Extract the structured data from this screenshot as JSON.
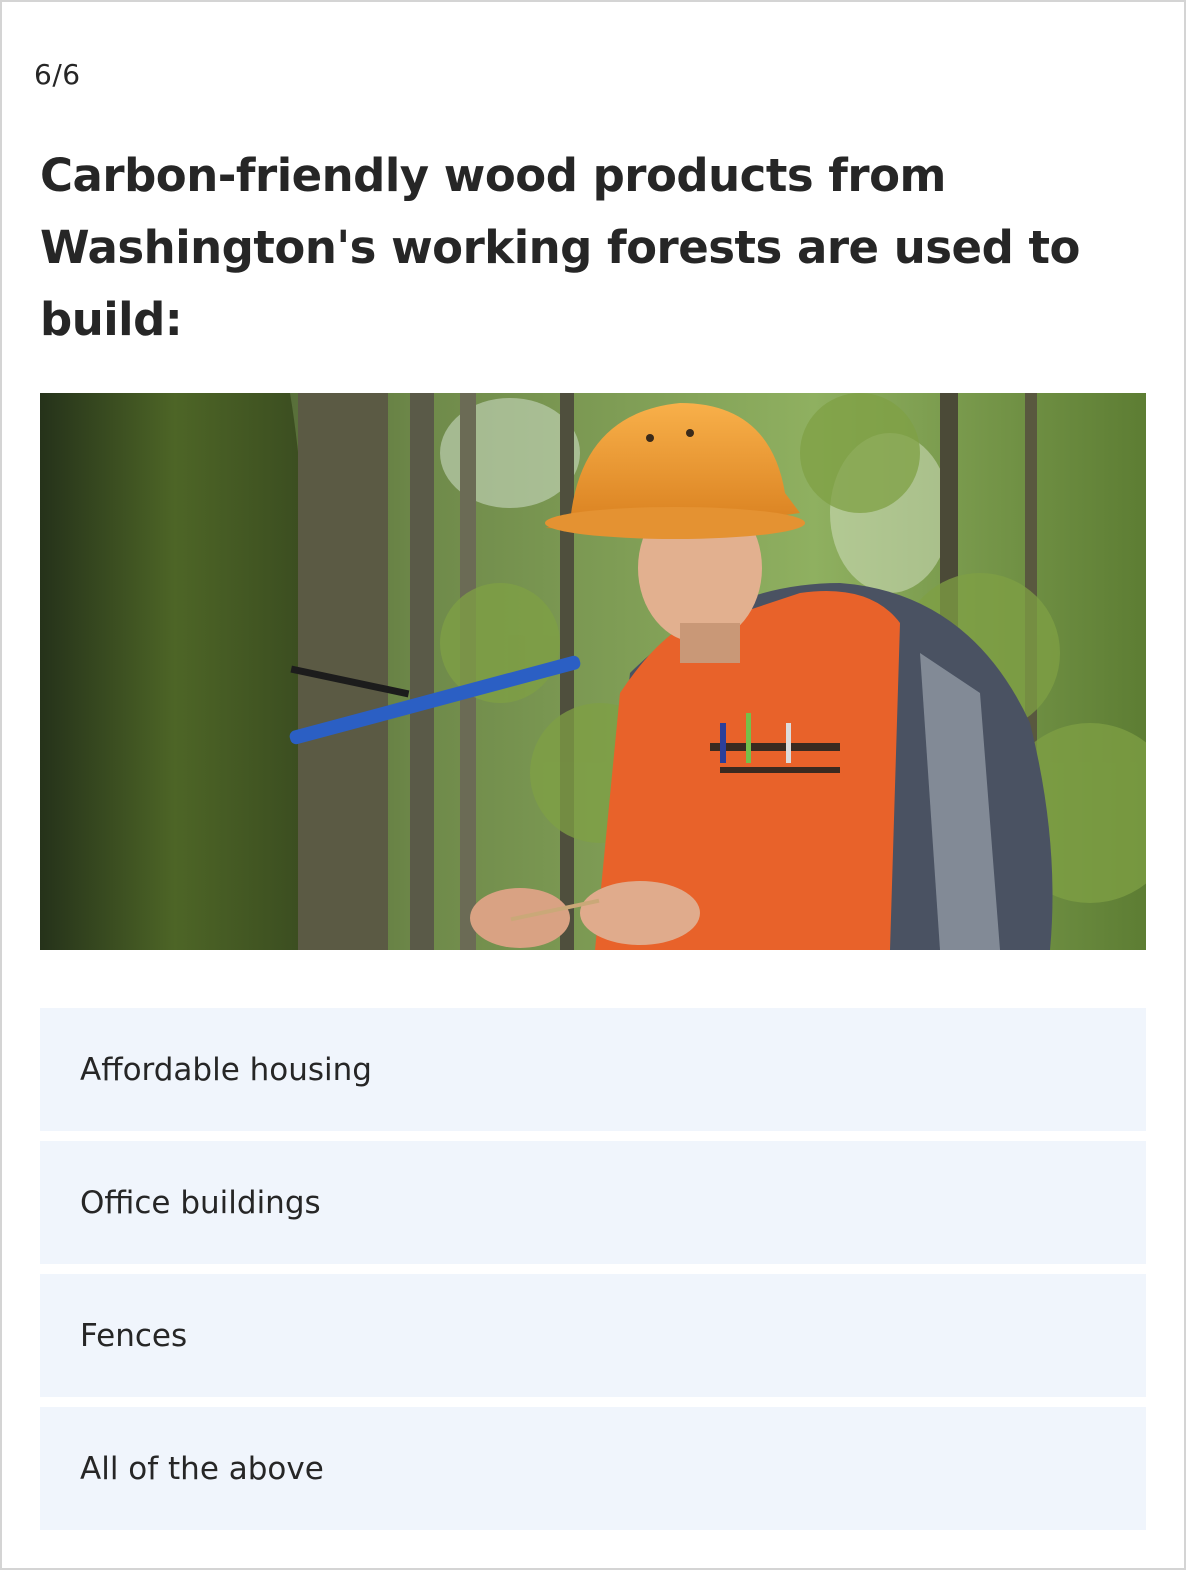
{
  "progress": {
    "label": "6/6"
  },
  "question": {
    "text": "Carbon-friendly wood products from Washington's working forests are used to build:"
  },
  "image": {
    "subject": "forester-in-hard-hat-photo"
  },
  "options": [
    {
      "label": "Affordable housing"
    },
    {
      "label": "Office buildings"
    },
    {
      "label": "Fences"
    },
    {
      "label": "All of the above"
    }
  ],
  "colors": {
    "option_background": "#f0f5fc",
    "text": "#262626",
    "frame_border": "#d4d4d4",
    "hard_hat": "#f09a2e",
    "safety_vest": "#e8622a"
  }
}
